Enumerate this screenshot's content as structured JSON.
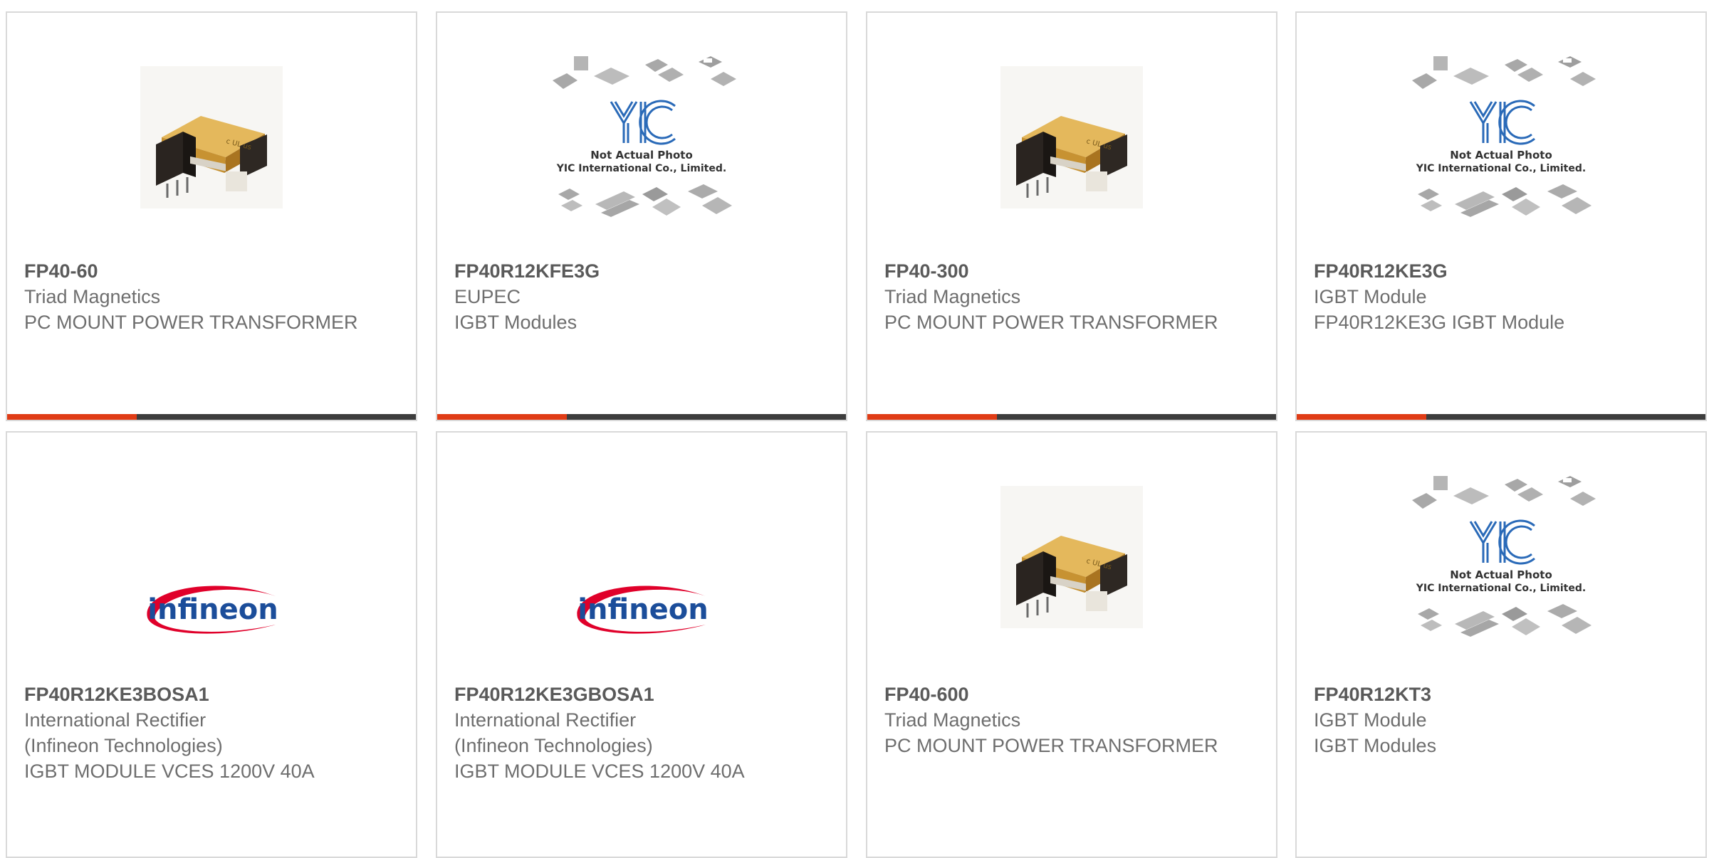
{
  "accent_color": "#e03c16",
  "products": [
    {
      "part_number": "FP40-60",
      "manufacturer": "Triad Magnetics",
      "description": "PC MOUNT POWER TRANSFORMER",
      "image": "transformer",
      "image_text": []
    },
    {
      "part_number": "FP40R12KFE3G",
      "manufacturer": "EUPEC",
      "description": "IGBT Modules",
      "image": "placeholder",
      "image_text": [
        "Not Actual Photo",
        "YIC International Co., Limited."
      ]
    },
    {
      "part_number": "FP40-300",
      "manufacturer": "Triad Magnetics",
      "description": "PC MOUNT POWER TRANSFORMER",
      "image": "transformer",
      "image_text": []
    },
    {
      "part_number": "FP40R12KE3G",
      "manufacturer": "IGBT Module",
      "description": "FP40R12KE3G IGBT Module",
      "image": "placeholder",
      "image_text": [
        "Not Actual Photo",
        "YIC International Co., Limited."
      ]
    },
    {
      "part_number": "FP40R12KE3BOSA1",
      "manufacturer": "International Rectifier (Infineon Technologies)",
      "description": "IGBT MODULE VCES 1200V 40A",
      "image": "infineon",
      "image_text": [
        "infineon"
      ]
    },
    {
      "part_number": "FP40R12KE3GBOSA1",
      "manufacturer": "International Rectifier (Infineon Technologies)",
      "description": "IGBT MODULE VCES 1200V 40A",
      "image": "infineon",
      "image_text": [
        "infineon"
      ]
    },
    {
      "part_number": "FP40-600",
      "manufacturer": "Triad Magnetics",
      "description": "PC MOUNT POWER TRANSFORMER",
      "image": "transformer",
      "image_text": []
    },
    {
      "part_number": "FP40R12KT3",
      "manufacturer": "IGBT Module",
      "description": "IGBT Modules",
      "image": "placeholder",
      "image_text": [
        "Not Actual Photo",
        "YIC International Co., Limited."
      ]
    }
  ]
}
